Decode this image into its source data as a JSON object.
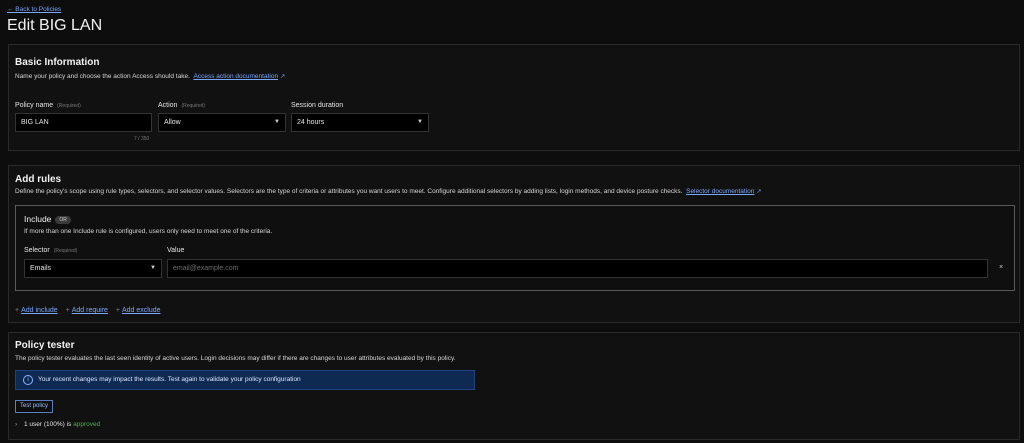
{
  "back_link": "← Back to Policies",
  "page_title": "Edit BIG LAN",
  "basic": {
    "title": "Basic Information",
    "desc": "Name your policy and choose the action Access should take.",
    "doc_link": "Access action documentation",
    "policy_name_label": "Policy name",
    "required": "(Required)",
    "policy_name_value": "BIG LAN",
    "counter": "7 / 350",
    "action_label": "Action",
    "action_value": "Allow",
    "session_label": "Session duration",
    "session_value": "24 hours"
  },
  "rules": {
    "title": "Add rules",
    "desc": "Define the policy's scope using rule types, selectors, and selector values. Selectors are the type of criteria or attributes you want users to meet. Configure additional selectors by adding lists, login methods, and device posture checks.",
    "doc_link": "Selector documentation",
    "include_title": "Include",
    "or_badge": "OR",
    "include_desc": "If more than one Include rule is configured, users only need to meet one of the criteria.",
    "selector_label": "Selector",
    "required": "(Required)",
    "value_label": "Value",
    "selector_value": "Emails",
    "value_placeholder": "email@example.com",
    "remove": "×",
    "add_include": "Add include",
    "add_require": "Add require",
    "add_exclude": "Add exclude"
  },
  "tester": {
    "title": "Policy tester",
    "desc": "The policy tester evaluates the last seen identity of active users. Login decisions may differ if there are changes to user attributes evaluated by this policy.",
    "banner": "Your recent changes may impact the results. Test again to validate your policy configuration",
    "test_button": "Test policy",
    "result_prefix": "1 user (100%) is",
    "result_status": "approved"
  }
}
